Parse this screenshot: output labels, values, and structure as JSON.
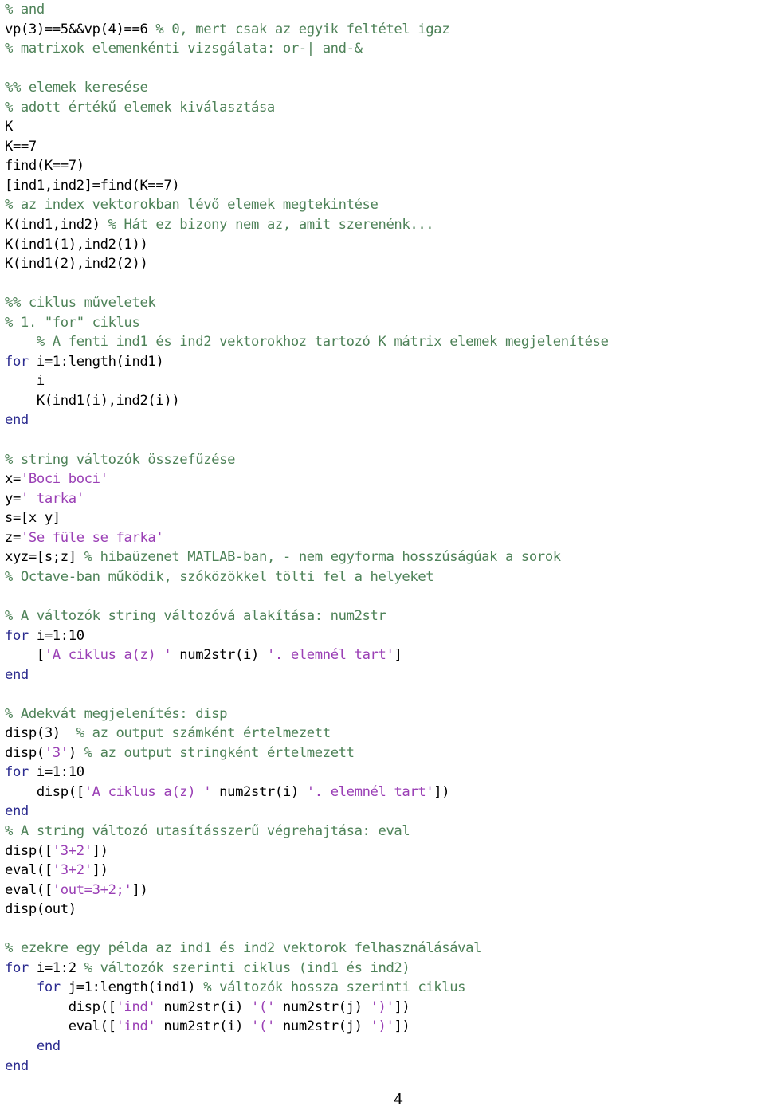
{
  "document": {
    "kind": "source-code-listing",
    "language": "MATLAB/Octave",
    "page_number": "4",
    "colors": {
      "background": "#ffffff",
      "code": "#000000",
      "comment": "#4e8258",
      "keyword": "#2b2b8f",
      "string": "#9a3fb5"
    }
  },
  "lines": [
    {
      "n": 1,
      "tokens": [
        {
          "t": "comment",
          "s": "% and"
        }
      ]
    },
    {
      "n": 2,
      "tokens": [
        {
          "t": "plain",
          "s": "vp(3)==5&&vp(4)==6 "
        },
        {
          "t": "comment",
          "s": "% 0, mert csak az egyik feltétel igaz"
        }
      ]
    },
    {
      "n": 3,
      "tokens": [
        {
          "t": "comment",
          "s": "% matrixok elemenkénti vizsgálata: or-| and-&"
        }
      ]
    },
    {
      "n": 4,
      "tokens": [
        {
          "t": "plain",
          "s": ""
        }
      ]
    },
    {
      "n": 5,
      "tokens": [
        {
          "t": "comment",
          "s": "%% elemek keresése"
        }
      ]
    },
    {
      "n": 6,
      "tokens": [
        {
          "t": "comment",
          "s": "% adott értékű elemek kiválasztása"
        }
      ]
    },
    {
      "n": 7,
      "tokens": [
        {
          "t": "plain",
          "s": "K"
        }
      ]
    },
    {
      "n": 8,
      "tokens": [
        {
          "t": "plain",
          "s": "K==7"
        }
      ]
    },
    {
      "n": 9,
      "tokens": [
        {
          "t": "plain",
          "s": "find(K==7)"
        }
      ]
    },
    {
      "n": 10,
      "tokens": [
        {
          "t": "plain",
          "s": "[ind1,ind2]=find(K==7)"
        }
      ]
    },
    {
      "n": 11,
      "tokens": [
        {
          "t": "comment",
          "s": "% az index vektorokban lévő elemek megtekintése"
        }
      ]
    },
    {
      "n": 12,
      "tokens": [
        {
          "t": "plain",
          "s": "K(ind1,ind2) "
        },
        {
          "t": "comment",
          "s": "% Hát ez bizony nem az, amit szerenénk..."
        }
      ]
    },
    {
      "n": 13,
      "tokens": [
        {
          "t": "plain",
          "s": "K(ind1(1),ind2(1))"
        }
      ]
    },
    {
      "n": 14,
      "tokens": [
        {
          "t": "plain",
          "s": "K(ind1(2),ind2(2))"
        }
      ]
    },
    {
      "n": 15,
      "tokens": [
        {
          "t": "plain",
          "s": ""
        }
      ]
    },
    {
      "n": 16,
      "tokens": [
        {
          "t": "comment",
          "s": "%% ciklus műveletek"
        }
      ]
    },
    {
      "n": 17,
      "tokens": [
        {
          "t": "comment",
          "s": "% 1. \"for\" ciklus"
        }
      ]
    },
    {
      "n": 18,
      "tokens": [
        {
          "t": "comment",
          "s": "    % A fenti ind1 és ind2 vektorokhoz tartozó K mátrix elemek megjelenítése"
        }
      ]
    },
    {
      "n": 19,
      "tokens": [
        {
          "t": "keyword",
          "s": "for"
        },
        {
          "t": "plain",
          "s": " i=1:length(ind1)"
        }
      ]
    },
    {
      "n": 20,
      "tokens": [
        {
          "t": "plain",
          "s": "    i"
        }
      ]
    },
    {
      "n": 21,
      "tokens": [
        {
          "t": "plain",
          "s": "    K(ind1(i),ind2(i))"
        }
      ]
    },
    {
      "n": 22,
      "tokens": [
        {
          "t": "keyword",
          "s": "end"
        }
      ]
    },
    {
      "n": 23,
      "tokens": [
        {
          "t": "plain",
          "s": ""
        }
      ]
    },
    {
      "n": 24,
      "tokens": [
        {
          "t": "comment",
          "s": "% string változók összefűzése"
        }
      ]
    },
    {
      "n": 25,
      "tokens": [
        {
          "t": "plain",
          "s": "x="
        },
        {
          "t": "string",
          "s": "'Boci boci'"
        }
      ]
    },
    {
      "n": 26,
      "tokens": [
        {
          "t": "plain",
          "s": "y="
        },
        {
          "t": "string",
          "s": "' tarka'"
        }
      ]
    },
    {
      "n": 27,
      "tokens": [
        {
          "t": "plain",
          "s": "s=[x y]"
        }
      ]
    },
    {
      "n": 28,
      "tokens": [
        {
          "t": "plain",
          "s": "z="
        },
        {
          "t": "string",
          "s": "'Se füle se farka'"
        }
      ]
    },
    {
      "n": 29,
      "tokens": [
        {
          "t": "plain",
          "s": "xyz=[s;z] "
        },
        {
          "t": "comment",
          "s": "% hibaüzenet MATLAB-ban, - nem egyforma hosszúságúak a sorok"
        }
      ]
    },
    {
      "n": 30,
      "tokens": [
        {
          "t": "comment",
          "s": "% Octave-ban működik, szóközökkel tölti fel a helyeket"
        }
      ]
    },
    {
      "n": 31,
      "tokens": [
        {
          "t": "plain",
          "s": ""
        }
      ]
    },
    {
      "n": 32,
      "tokens": [
        {
          "t": "comment",
          "s": "% A változók string változóvá alakítása: num2str"
        }
      ]
    },
    {
      "n": 33,
      "tokens": [
        {
          "t": "keyword",
          "s": "for"
        },
        {
          "t": "plain",
          "s": " i=1:10"
        }
      ]
    },
    {
      "n": 34,
      "tokens": [
        {
          "t": "plain",
          "s": "    ["
        },
        {
          "t": "string",
          "s": "'A ciklus a(z) '"
        },
        {
          "t": "plain",
          "s": " num2str(i) "
        },
        {
          "t": "string",
          "s": "'. elemnél tart'"
        },
        {
          "t": "plain",
          "s": "]"
        }
      ]
    },
    {
      "n": 35,
      "tokens": [
        {
          "t": "keyword",
          "s": "end"
        }
      ]
    },
    {
      "n": 36,
      "tokens": [
        {
          "t": "plain",
          "s": ""
        }
      ]
    },
    {
      "n": 37,
      "tokens": [
        {
          "t": "comment",
          "s": "% Adekvát megjelenítés: disp"
        }
      ]
    },
    {
      "n": 38,
      "tokens": [
        {
          "t": "plain",
          "s": "disp(3)  "
        },
        {
          "t": "comment",
          "s": "% az output számként értelmezett"
        }
      ]
    },
    {
      "n": 39,
      "tokens": [
        {
          "t": "plain",
          "s": "disp("
        },
        {
          "t": "string",
          "s": "'3'"
        },
        {
          "t": "plain",
          "s": ") "
        },
        {
          "t": "comment",
          "s": "% az output stringként értelmezett"
        }
      ]
    },
    {
      "n": 40,
      "tokens": [
        {
          "t": "keyword",
          "s": "for"
        },
        {
          "t": "plain",
          "s": " i=1:10"
        }
      ]
    },
    {
      "n": 41,
      "tokens": [
        {
          "t": "plain",
          "s": "    disp(["
        },
        {
          "t": "string",
          "s": "'A ciklus a(z) '"
        },
        {
          "t": "plain",
          "s": " num2str(i) "
        },
        {
          "t": "string",
          "s": "'. elemnél tart'"
        },
        {
          "t": "plain",
          "s": "])"
        }
      ]
    },
    {
      "n": 42,
      "tokens": [
        {
          "t": "keyword",
          "s": "end"
        }
      ]
    },
    {
      "n": 43,
      "tokens": [
        {
          "t": "comment",
          "s": "% A string változó utasításszerű végrehajtása: eval"
        }
      ]
    },
    {
      "n": 44,
      "tokens": [
        {
          "t": "plain",
          "s": "disp(["
        },
        {
          "t": "string",
          "s": "'3+2'"
        },
        {
          "t": "plain",
          "s": "])"
        }
      ]
    },
    {
      "n": 45,
      "tokens": [
        {
          "t": "plain",
          "s": "eval(["
        },
        {
          "t": "string",
          "s": "'3+2'"
        },
        {
          "t": "plain",
          "s": "])"
        }
      ]
    },
    {
      "n": 46,
      "tokens": [
        {
          "t": "plain",
          "s": "eval(["
        },
        {
          "t": "string",
          "s": "'out=3+2;'"
        },
        {
          "t": "plain",
          "s": "])"
        }
      ]
    },
    {
      "n": 47,
      "tokens": [
        {
          "t": "plain",
          "s": "disp(out)"
        }
      ]
    },
    {
      "n": 48,
      "tokens": [
        {
          "t": "plain",
          "s": ""
        }
      ]
    },
    {
      "n": 49,
      "tokens": [
        {
          "t": "comment",
          "s": "% ezekre egy példa az ind1 és ind2 vektorok felhasználásával"
        }
      ]
    },
    {
      "n": 50,
      "tokens": [
        {
          "t": "keyword",
          "s": "for"
        },
        {
          "t": "plain",
          "s": " i=1:2 "
        },
        {
          "t": "comment",
          "s": "% változók szerinti ciklus (ind1 és ind2)"
        }
      ]
    },
    {
      "n": 51,
      "tokens": [
        {
          "t": "plain",
          "s": "    "
        },
        {
          "t": "keyword",
          "s": "for"
        },
        {
          "t": "plain",
          "s": " j=1:length(ind1) "
        },
        {
          "t": "comment",
          "s": "% változók hossza szerinti ciklus"
        }
      ]
    },
    {
      "n": 52,
      "tokens": [
        {
          "t": "plain",
          "s": "        disp(["
        },
        {
          "t": "string",
          "s": "'ind'"
        },
        {
          "t": "plain",
          "s": " num2str(i) "
        },
        {
          "t": "string",
          "s": "'('"
        },
        {
          "t": "plain",
          "s": " num2str(j) "
        },
        {
          "t": "string",
          "s": "')'"
        },
        {
          "t": "plain",
          "s": "])"
        }
      ]
    },
    {
      "n": 53,
      "tokens": [
        {
          "t": "plain",
          "s": "        eval(["
        },
        {
          "t": "string",
          "s": "'ind'"
        },
        {
          "t": "plain",
          "s": " num2str(i) "
        },
        {
          "t": "string",
          "s": "'('"
        },
        {
          "t": "plain",
          "s": " num2str(j) "
        },
        {
          "t": "string",
          "s": "')'"
        },
        {
          "t": "plain",
          "s": "])"
        }
      ]
    },
    {
      "n": 54,
      "tokens": [
        {
          "t": "plain",
          "s": "    "
        },
        {
          "t": "keyword",
          "s": "end"
        }
      ]
    },
    {
      "n": 55,
      "tokens": [
        {
          "t": "keyword",
          "s": "end"
        }
      ]
    }
  ]
}
